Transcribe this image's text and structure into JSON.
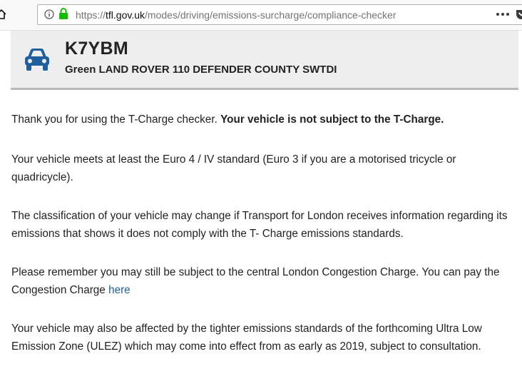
{
  "browser": {
    "url_scheme": "https://",
    "url_host": "tfl.gov.uk",
    "url_path": "/modes/driving/emissions-surcharge/compliance-checker"
  },
  "vehicle": {
    "registration": "K7YBM",
    "description": "Green LAND ROVER 110 DEFENDER COUNTY SWTDI",
    "icon_color": "#1f5fa0"
  },
  "result": {
    "p1_intro": "Thank you for using the T-Charge checker. ",
    "p1_status": "Your vehicle is not subject to the T-Charge.",
    "p2": "Your vehicle meets at least the Euro 4 / IV standard (Euro 3 if you are a motorised tricycle or quadricycle).",
    "p3": "The classification of your vehicle may change if Transport for London receives information regarding its emissions that shows it does not comply with the T- Charge emissions standards.",
    "p4_text": "Please remember you may still be subject to the central London Congestion Charge. You can pay the Congestion Charge ",
    "p4_link": "here",
    "p5": "Your vehicle may also be affected by the tighter emissions standards of the forthcoming Ultra Low Emission Zone (ULEZ) which may come into effect from as early as 2019, subject to consultation."
  },
  "colors": {
    "link": "#1f5fa0",
    "panel_bg": "#eeeeee",
    "secure_lock": "#12bc00"
  }
}
